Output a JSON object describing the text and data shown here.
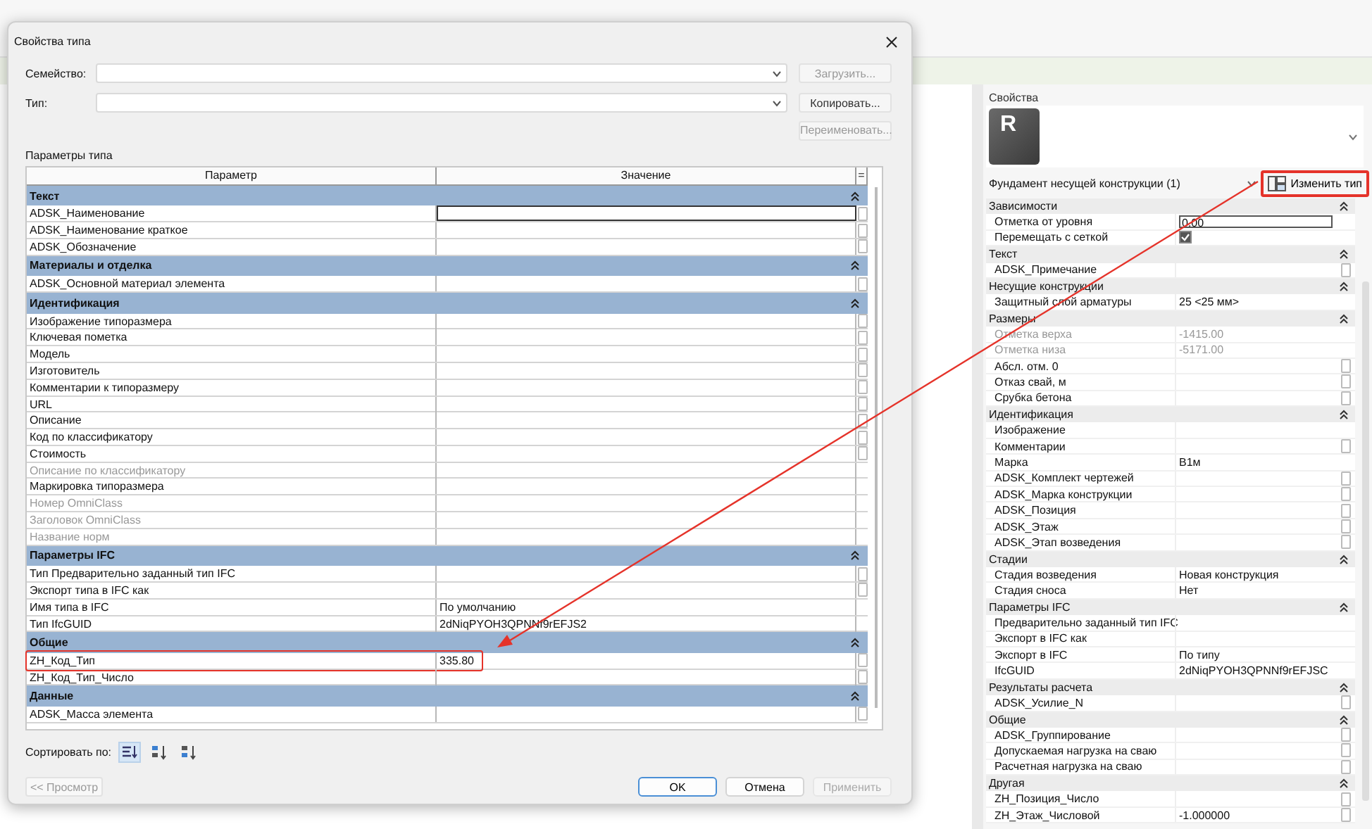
{
  "dialog": {
    "title": "Свойства типа",
    "fields": [
      {
        "label": "Семейство:",
        "button": "Загрузить...",
        "button_disabled": true
      },
      {
        "label": "Тип:",
        "button": "Копировать...",
        "button_disabled": false
      }
    ],
    "rename_button": "Переименовать...",
    "section_label": "Параметры типа",
    "columns": [
      "Параметр",
      "Значение",
      "="
    ],
    "groups": [
      {
        "name": "Текст",
        "rows": [
          {
            "name": "ADSK_Наименование",
            "disabled": false,
            "linkable": true,
            "editing": true,
            "highlighted": false
          },
          {
            "name": "ADSK_Наименование краткое",
            "disabled": false,
            "linkable": true,
            "editing": false,
            "highlighted": false
          },
          {
            "name": "ADSK_Обозначение",
            "disabled": false,
            "linkable": true,
            "editing": false,
            "highlighted": false
          }
        ]
      },
      {
        "name": "Материалы и отделка",
        "rows": [
          {
            "name": "ADSK_Основной материал элемента",
            "disabled": false,
            "linkable": true,
            "editing": false,
            "highlighted": false
          }
        ]
      },
      {
        "name": "Идентификация",
        "rows": [
          {
            "name": "Изображение типоразмера",
            "disabled": false,
            "linkable": true,
            "editing": false,
            "highlighted": false
          },
          {
            "name": "Ключевая пометка",
            "disabled": false,
            "linkable": true,
            "editing": false,
            "highlighted": false
          },
          {
            "name": "Модель",
            "disabled": false,
            "linkable": true,
            "editing": false,
            "highlighted": false
          },
          {
            "name": "Изготовитель",
            "disabled": false,
            "linkable": true,
            "editing": false,
            "highlighted": false
          },
          {
            "name": "Комментарии к типоразмеру",
            "disabled": false,
            "linkable": true,
            "editing": false,
            "highlighted": false
          },
          {
            "name": "URL",
            "disabled": false,
            "linkable": true,
            "editing": false,
            "highlighted": false
          },
          {
            "name": "Описание",
            "disabled": false,
            "linkable": true,
            "editing": false,
            "highlighted": false
          },
          {
            "name": "Код по классификатору",
            "disabled": false,
            "linkable": true,
            "editing": false,
            "highlighted": false
          },
          {
            "name": "Стоимость",
            "disabled": false,
            "linkable": true,
            "editing": false,
            "highlighted": false
          },
          {
            "name": "Описание по классификатору",
            "disabled": true,
            "linkable": false,
            "editing": false,
            "highlighted": false
          },
          {
            "name": "Маркировка типоразмера",
            "disabled": false,
            "linkable": false,
            "editing": false,
            "highlighted": false
          },
          {
            "name": "Номер OmniClass",
            "disabled": true,
            "linkable": false,
            "editing": false,
            "highlighted": false
          },
          {
            "name": "Заголовок OmniClass",
            "disabled": true,
            "linkable": false,
            "editing": false,
            "highlighted": false
          },
          {
            "name": "Название норм",
            "disabled": true,
            "linkable": false,
            "editing": false,
            "highlighted": false
          }
        ]
      },
      {
        "name": "Параметры IFC",
        "rows": [
          {
            "name": "Тип Предварительно заданный тип IFC",
            "disabled": false,
            "linkable": true,
            "editing": false,
            "highlighted": false
          },
          {
            "name": "Экспорт типа в IFC как",
            "disabled": false,
            "linkable": true,
            "editing": false,
            "highlighted": false
          },
          {
            "name": "Имя типа в IFC",
            "value": "По умолчанию",
            "disabled": false,
            "linkable": false,
            "editing": false,
            "highlighted": false
          },
          {
            "name": "Тип IfcGUID",
            "value": "2dNiqPYOH3QPNNf9rEFJS2",
            "disabled": false,
            "linkable": false,
            "editing": false,
            "highlighted": false
          }
        ]
      },
      {
        "name": "Общие",
        "rows": [
          {
            "name": "ZH_Код_Тип",
            "value": "335.80",
            "disabled": false,
            "linkable": true,
            "editing": false,
            "highlighted": true
          },
          {
            "name": "ZH_Код_Тип_Число",
            "disabled": false,
            "linkable": true,
            "editing": false,
            "highlighted": false
          }
        ]
      },
      {
        "name": "Данные",
        "rows": [
          {
            "name": "ADSK_Масса элемента",
            "disabled": false,
            "linkable": true,
            "editing": false,
            "highlighted": false
          }
        ]
      }
    ],
    "sort_label": "Сортировать по:",
    "sort_options": [
      {
        "kind": "grouped",
        "selected": true
      },
      {
        "kind": "ascending",
        "selected": false
      },
      {
        "kind": "descending",
        "selected": false
      }
    ],
    "preview_button": "<< Просмотр",
    "buttons": [
      {
        "label": "OK",
        "kind": "default",
        "disabled": false
      },
      {
        "label": "Отмена",
        "kind": "normal",
        "disabled": false
      },
      {
        "label": "Применить",
        "kind": "normal",
        "disabled": true
      }
    ]
  },
  "properties": {
    "title": "Свойства",
    "type_image_letter": "R",
    "type_selector": "Фундамент несущей конструкции (1)",
    "edit_type_button": {
      "label": "Изменить тип",
      "highlighted": true
    },
    "groups": [
      {
        "name": "Зависимости",
        "rows": [
          {
            "name": "Отметка от уровня",
            "value": "0.00",
            "kind": "input",
            "disabled": false,
            "linkable": false
          },
          {
            "name": "Перемещать с сеткой",
            "kind": "checkbox",
            "checked": true,
            "disabled": false,
            "linkable": false
          }
        ]
      },
      {
        "name": "Текст",
        "rows": [
          {
            "name": "ADSK_Примечание",
            "kind": "text",
            "disabled": false,
            "linkable": true
          }
        ]
      },
      {
        "name": "Несущие конструкции",
        "rows": [
          {
            "name": "Защитный слой арматуры",
            "value": "25 <25 мм>",
            "kind": "text",
            "disabled": false,
            "linkable": false
          }
        ]
      },
      {
        "name": "Размеры",
        "rows": [
          {
            "name": "Отметка верха",
            "value": "-1415.00",
            "kind": "text",
            "disabled": true,
            "linkable": false
          },
          {
            "name": "Отметка низа",
            "value": "-5171.00",
            "kind": "text",
            "disabled": true,
            "linkable": false
          },
          {
            "name": "Абсл. отм. 0",
            "kind": "text",
            "disabled": false,
            "linkable": true
          },
          {
            "name": "Отказ свай, м",
            "kind": "text",
            "disabled": false,
            "linkable": true
          },
          {
            "name": "Срубка бетона",
            "kind": "text",
            "disabled": false,
            "linkable": true
          }
        ]
      },
      {
        "name": "Идентификация",
        "rows": [
          {
            "name": "Изображение",
            "kind": "text",
            "disabled": false,
            "linkable": false
          },
          {
            "name": "Комментарии",
            "kind": "text",
            "disabled": false,
            "linkable": true
          },
          {
            "name": "Марка",
            "value": "В1м",
            "kind": "text",
            "disabled": false,
            "linkable": false
          },
          {
            "name": "ADSK_Комплект чертежей",
            "kind": "text",
            "disabled": false,
            "linkable": true
          },
          {
            "name": "ADSK_Марка конструкции",
            "kind": "text",
            "disabled": false,
            "linkable": true
          },
          {
            "name": "ADSK_Позиция",
            "kind": "text",
            "disabled": false,
            "linkable": true
          },
          {
            "name": "ADSK_Этаж",
            "kind": "text",
            "disabled": false,
            "linkable": true
          },
          {
            "name": "ADSK_Этап возведения",
            "kind": "text",
            "disabled": false,
            "linkable": true
          }
        ]
      },
      {
        "name": "Стадии",
        "rows": [
          {
            "name": "Стадия возведения",
            "value": "Новая конструкция",
            "kind": "text",
            "disabled": false,
            "linkable": false
          },
          {
            "name": "Стадия сноса",
            "value": "Нет",
            "kind": "text",
            "disabled": false,
            "linkable": false
          }
        ]
      },
      {
        "name": "Параметры IFC",
        "rows": [
          {
            "name": "Предварительно заданный тип IFC",
            "kind": "text",
            "disabled": false,
            "linkable": false
          },
          {
            "name": "Экспорт в IFC как",
            "kind": "text",
            "disabled": false,
            "linkable": false
          },
          {
            "name": "Экспорт в IFC",
            "value": "По типу",
            "kind": "text",
            "disabled": false,
            "linkable": false
          },
          {
            "name": "IfcGUID",
            "value": "2dNiqPYOH3QPNNf9rEFJSC",
            "kind": "text",
            "disabled": false,
            "linkable": false
          }
        ]
      },
      {
        "name": "Результаты расчета",
        "rows": [
          {
            "name": "ADSK_Усилие_N",
            "kind": "text",
            "disabled": false,
            "linkable": true
          }
        ]
      },
      {
        "name": "Общие",
        "rows": [
          {
            "name": "ADSK_Группирование",
            "kind": "text",
            "disabled": false,
            "linkable": true
          },
          {
            "name": "Допускаемая нагрузка на сваю",
            "kind": "text",
            "disabled": false,
            "linkable": true
          },
          {
            "name": "Расчетная нагрузка на сваю",
            "kind": "text",
            "disabled": false,
            "linkable": true
          }
        ]
      },
      {
        "name": "Другая",
        "rows": [
          {
            "name": "ZH_Позиция_Число",
            "kind": "text",
            "disabled": false,
            "linkable": true
          },
          {
            "name": "ZH_Этаж_Числовой",
            "value": "-1.000000",
            "kind": "text",
            "disabled": false,
            "linkable": true
          }
        ]
      }
    ]
  }
}
